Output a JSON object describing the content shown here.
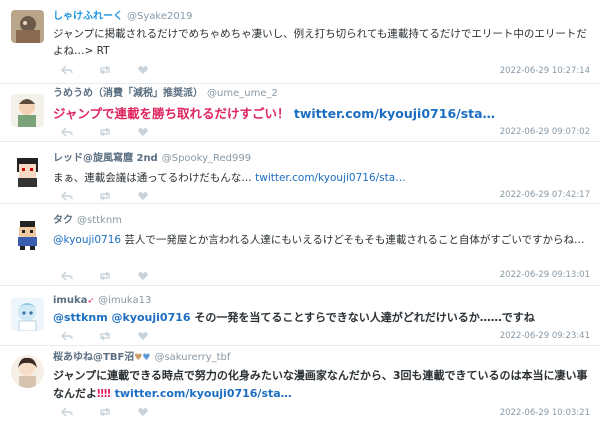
{
  "tweets": [
    {
      "name": "しゃけふれーく",
      "handle": "@Syake2019",
      "text": "ジャンプに掲載されるだけでめちゃめちゃ凄いし、例え打ち切られても連載持てるだけでエリート中のエリートだよね…> RT",
      "time": "2022-06-29 10:27:14"
    },
    {
      "name": "うめうめ（消費「減税」推奨派）",
      "handle": "@ume_ume_2",
      "text_red": "ジャンプで連載を勝ち取れるだけすごい！",
      "link": "twitter.com/kyouji0716/sta…",
      "time": "2022-06-29 09:07:02"
    },
    {
      "name": "レッド@旋風寫麿 2nd",
      "handle": "@Spooky_Red999",
      "text": "まぁ、連載会議は通ってるわけだもんな…",
      "link": "twitter.com/kyouji0716/sta…",
      "time": "2022-06-29 07:42:17"
    },
    {
      "name": "タク",
      "handle": "@sttknm",
      "mention": "@kyouji0716",
      "text": "芸人で一発屋とか言われる人達にもいえるけどそもそも連載されること自体がすごいですからね…",
      "time": "2022-06-29 09:13:01"
    },
    {
      "name": "imuka",
      "handle": "@imuka13",
      "mention": "@sttknm @kyouji0716",
      "text": "その一発を当てることすらできない人達がどれだけいるか……ですね",
      "time": "2022-06-29 09:23:41"
    },
    {
      "name": "桜あゆね@TBF沼",
      "handle": "@sakurerry_tbf",
      "text_a": "ジャンプに連載できる時点で努力の化身みたいな漫画家なんだから、3回も連載できているのは本当に凄い事なんだよ",
      "exclaim": "‼‼",
      "link": "twitter.com/kyouji0716/sta…",
      "time": "2022-06-29 10:03:21"
    }
  ],
  "icons": [
    "reply-icon",
    "retweet-icon",
    "like-icon"
  ],
  "colors": {
    "accent_link": "#1b6ec2",
    "name_blue": "#1b95e0",
    "emphasis_red": "#e0245e",
    "muted": "#8899a6"
  }
}
